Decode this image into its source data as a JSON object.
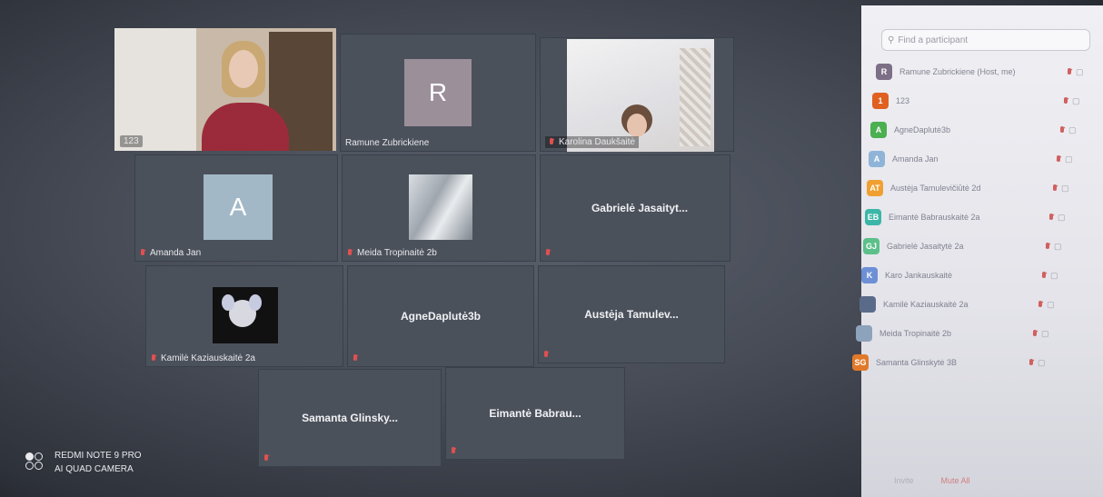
{
  "gallery": {
    "tiles": [
      {
        "name": "123",
        "type": "video",
        "active": true
      },
      {
        "name": "Ramune Zubrickiene",
        "type": "avatar",
        "initial": "R",
        "avatar_color": "#9b8f9a"
      },
      {
        "name": "Karolina Daukšaitė",
        "type": "video"
      },
      {
        "name": "Amanda Jan",
        "type": "avatar",
        "initial": "A",
        "avatar_color": "#a3b8c6"
      },
      {
        "name": "Meida Tropinaitė 2b",
        "type": "picture"
      },
      {
        "name": "",
        "type": "name",
        "center": "Gabrielė Jasaityt..."
      },
      {
        "name": "Kamilė Kaziauskaitė 2a",
        "type": "picture"
      },
      {
        "name": "",
        "type": "name",
        "center": "AgneDaplutė3b"
      },
      {
        "name": "",
        "type": "name",
        "center": "Austėja Tamulev..."
      },
      {
        "name": "",
        "type": "name",
        "center": "Samanta Glinsky..."
      },
      {
        "name": "",
        "type": "name",
        "center": "Eimantė Babrau..."
      }
    ]
  },
  "participants": {
    "search_placeholder": "Find a participant",
    "items": [
      {
        "initial": "R",
        "name": "Ramune Zubrickiene (Host, me)",
        "color": "#7d6f86"
      },
      {
        "initial": "1",
        "name": "123",
        "color": "#e0601f"
      },
      {
        "initial": "A",
        "name": "AgneDaplutė3b",
        "color": "#4caf50"
      },
      {
        "initial": "A",
        "name": "Amanda Jan",
        "color": "#8fb4d8"
      },
      {
        "initial": "AT",
        "name": "Austėja Tamulevičiūtė 2d",
        "color": "#f0a030"
      },
      {
        "initial": "EB",
        "name": "Eimantė Babrauskaitė 2a",
        "color": "#3cb6a8"
      },
      {
        "initial": "GJ",
        "name": "Gabrielė Jasaitytė 2a",
        "color": "#5cc08a"
      },
      {
        "initial": "K",
        "name": "Karo Jankauskaitė",
        "color": "#6c8fd6"
      },
      {
        "initial": "",
        "name": "Kamilė Kaziauskaitė 2a",
        "color": "#5a6b8a"
      },
      {
        "initial": "",
        "name": "Meida Tropinaitė 2b",
        "color": "#8da2bb"
      },
      {
        "initial": "SG",
        "name": "Samanta Glinskytė 3B",
        "color": "#e07a2a"
      }
    ],
    "footer": [
      "Invite",
      "Mute All"
    ]
  },
  "watermark": {
    "line1": "REDMI NOTE 9 PRO",
    "line2": "AI QUAD CAMERA"
  }
}
